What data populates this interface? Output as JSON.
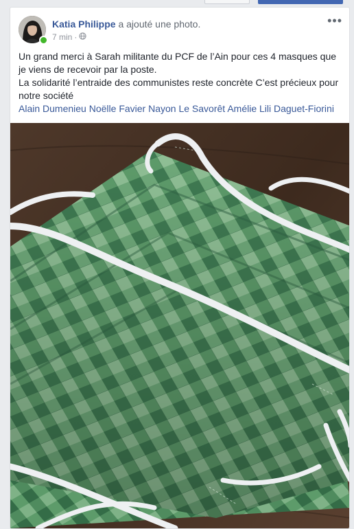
{
  "post": {
    "author": "Katia Philippe",
    "action": "a ajouté une photo.",
    "time": "7 min",
    "separator": "·",
    "more_icon": "ellipsis-icon",
    "privacy_icon": "globe-icon",
    "text_lines": [
      "Un grand merci à Sarah militante du PCF de l’Ain pour ces 4 masques que je viens de recevoir par la poste.",
      "La solidarité l’entraide des communistes reste concrète C’est précieux pour notre société"
    ],
    "tags": [
      "Alain Dumenieu",
      "Noëlle Favier Nayon",
      "Le Savorêt",
      "Amélie Lili Daguet-Fiorini"
    ]
  },
  "colors": {
    "link": "#385898",
    "online": "#42b72a",
    "mask_dark": "#3f7a52",
    "mask_light": "#8fbf95",
    "elastic": "#eef0f2",
    "table": "#4a3526"
  }
}
